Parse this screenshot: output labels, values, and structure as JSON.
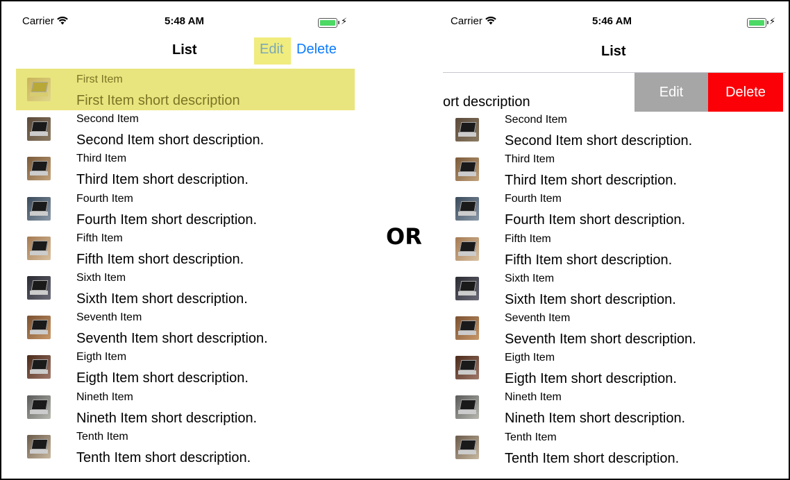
{
  "left_screen": {
    "status": {
      "carrier": "Carrier",
      "time": "5:48 AM"
    },
    "nav": {
      "title": "List",
      "edit_label": "Edit",
      "delete_label": "Delete"
    }
  },
  "right_screen": {
    "status": {
      "carrier": "Carrier",
      "time": "5:46 AM"
    },
    "nav": {
      "title": "List"
    },
    "swiped_row_visible_text": "ort description",
    "actions": {
      "edit_label": "Edit",
      "delete_label": "Delete"
    }
  },
  "separator_text": "OR",
  "items": [
    {
      "title": "First Item",
      "description": "First Item short description"
    },
    {
      "title": "Second Item",
      "description": "Second Item short description."
    },
    {
      "title": "Third Item",
      "description": "Third Item short description."
    },
    {
      "title": "Fourth Item",
      "description": "Fourth Item short description."
    },
    {
      "title": "Fifth Item",
      "description": "Fifth Item short description."
    },
    {
      "title": "Sixth Item",
      "description": "Sixth Item short description."
    },
    {
      "title": "Seventh Item",
      "description": "Seventh Item short description."
    },
    {
      "title": "Eigth Item",
      "description": "Eigth Item short description."
    },
    {
      "title": "Nineth Item",
      "description": "Nineth Item short description."
    },
    {
      "title": "Tenth Item",
      "description": "Tenth Item short description."
    }
  ],
  "colors": {
    "tint": "#0a7aff",
    "highlight": "#e9e57e",
    "edit_action": "#a6a6a6",
    "delete_action": "#fb0007",
    "battery": "#4cd964"
  },
  "icons": [
    "wifi-icon",
    "battery-icon",
    "charging-bolt-icon",
    "laptop-thumbnail"
  ]
}
